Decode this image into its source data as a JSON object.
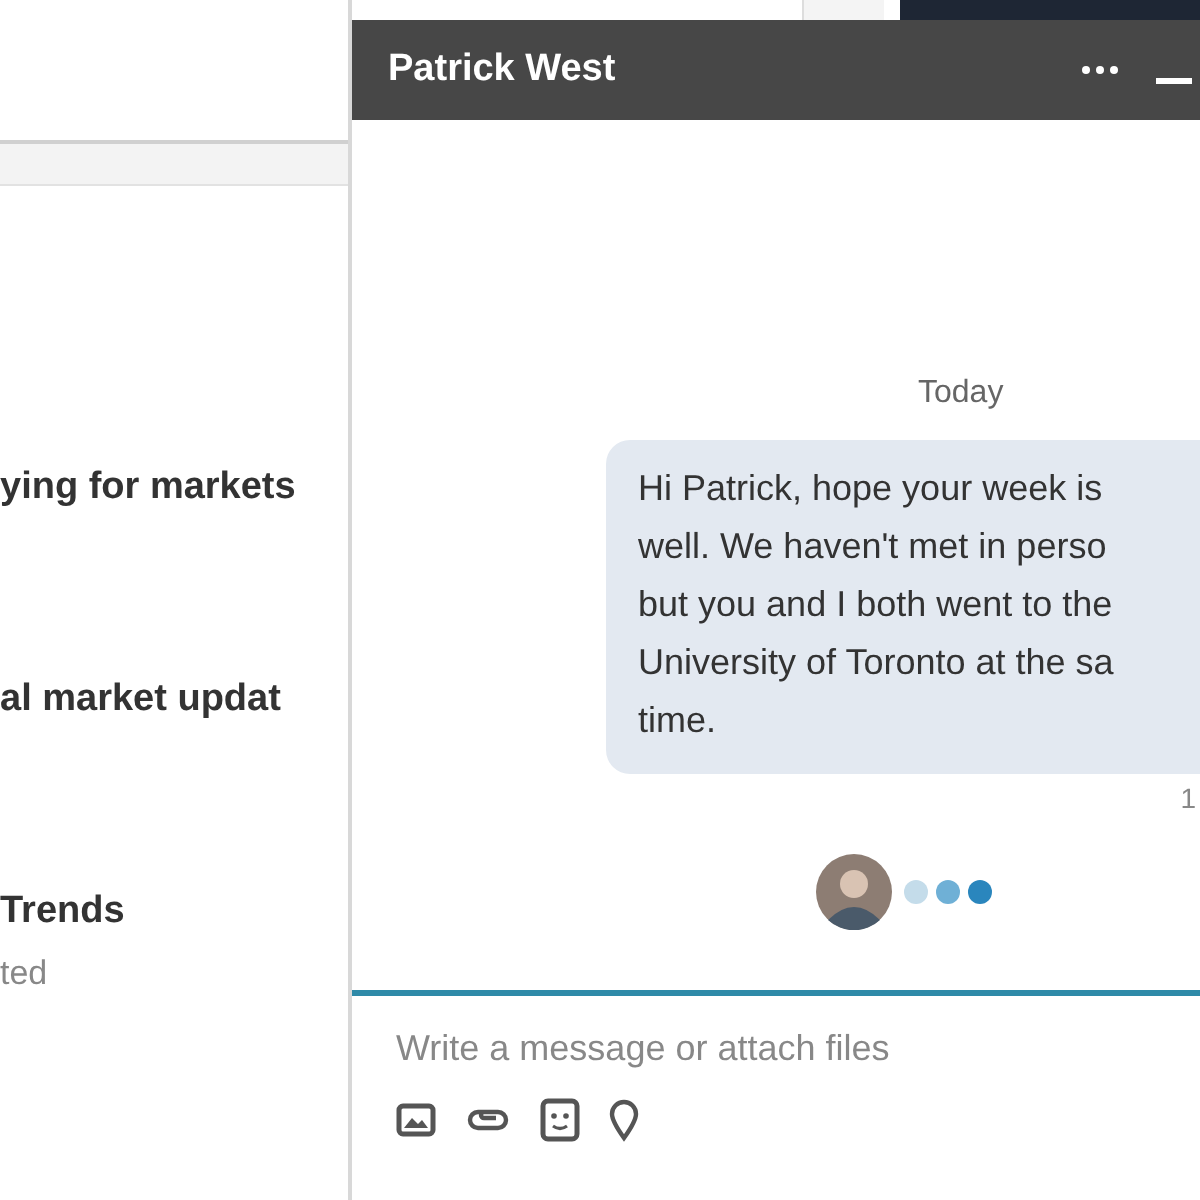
{
  "feed": {
    "items": [
      {
        "title": "ying for markets"
      },
      {
        "title": "al market updat"
      },
      {
        "title": "Trends",
        "subtitle": "ted"
      }
    ]
  },
  "chat": {
    "title": "Patrick West",
    "date_divider": "Today",
    "messages": [
      {
        "lines": [
          "Hi Patrick, hope your week is",
          "well. We haven't met in perso",
          "but you and I both went to the",
          "University of Toronto at the sa",
          "time."
        ],
        "time": "1"
      }
    ],
    "typing": true,
    "composer": {
      "placeholder": "Write a message or attach files"
    }
  }
}
